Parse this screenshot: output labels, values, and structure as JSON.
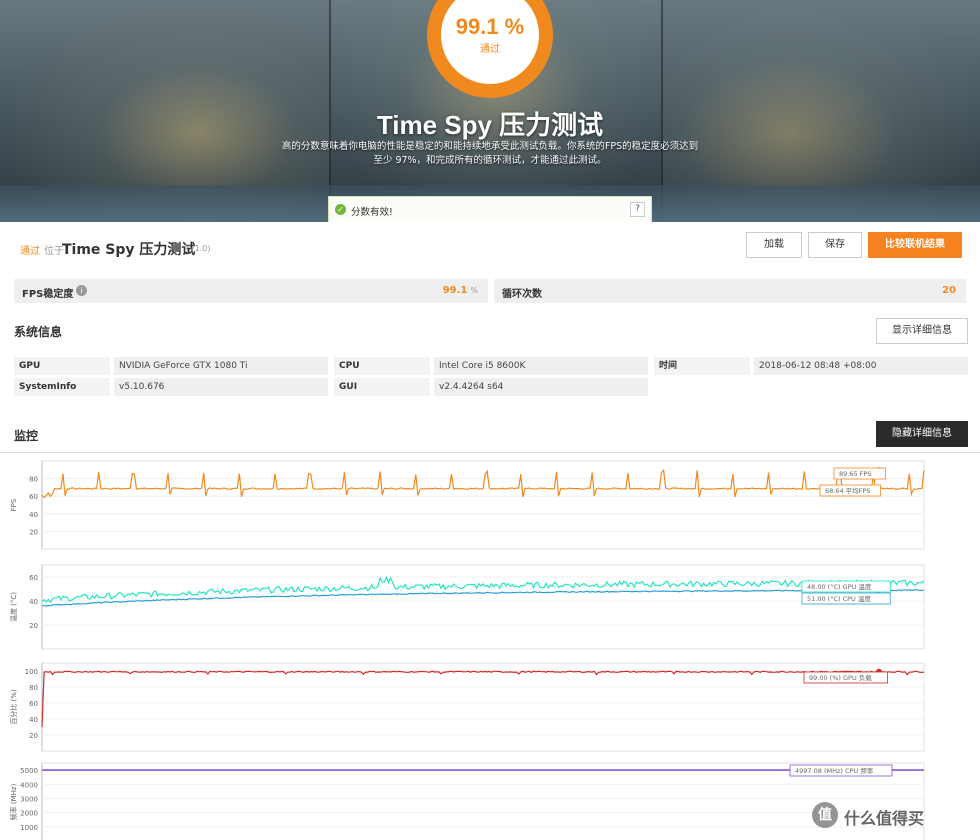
{
  "hero": {
    "score": "99.1 %",
    "status": "通过",
    "title": "Time Spy 压力测试",
    "description": "高的分数意味着你电脑的性能是稳定的和能持续地承受此测试负载。你系统的FPS的稳定度必须达到至少 97%，和完成所有的循环测试，才能通过此测试。",
    "valid_text": "分数有效!",
    "help_label": "?"
  },
  "result": {
    "status": "通过",
    "position_word": "位于",
    "test_name": "Time Spy 压力测试",
    "version": "(V1.0)",
    "load_label": "加载",
    "save_label": "保存",
    "compare_label": "比较联机结果"
  },
  "stats": {
    "fps_label": "FPS稳定度",
    "fps_value": "99.1",
    "fps_unit": "%",
    "loop_label": "循环次数",
    "loop_value": "20"
  },
  "system": {
    "title": "系统信息",
    "details_button": "显示详细信息",
    "gpu_key": "GPU",
    "gpu_val": "NVIDIA GeForce GTX 1080 Ti",
    "cpu_key": "CPU",
    "cpu_val": "Intel Core i5 8600K",
    "time_key": "时间",
    "time_val": "2018-06-12 08:48 +08:00",
    "sysinfo_key": "SystemInfo",
    "sysinfo_val": "v5.10.676",
    "gui_key": "GUI",
    "gui_val": "v2.4.4264 s64"
  },
  "monitor": {
    "title": "监控",
    "hide_button": "隐藏详细信息"
  },
  "chart_data": [
    {
      "type": "line",
      "ylabel": "FPS",
      "ylim": [
        0,
        100
      ],
      "yticks": [
        "80",
        "60",
        "40",
        "20"
      ],
      "series": [
        {
          "name": "FPS",
          "color": "#f08a1f",
          "baseline": 68.64,
          "peak": 89.65,
          "spike_count": 25
        }
      ],
      "labels": [
        "89.65 FPS",
        "68.64 平均FPS"
      ]
    },
    {
      "type": "line",
      "ylabel": "温度 (°C)",
      "ylim": [
        0,
        70
      ],
      "yticks": [
        "60",
        "40",
        "20"
      ],
      "series": [
        {
          "name": "GPU 温度",
          "color": "#23e5c0",
          "start": 40,
          "end": 54
        },
        {
          "name": "CPU 温度",
          "color": "#2a9fd6",
          "start": 36,
          "end": 49
        }
      ],
      "labels": [
        "48.00 (°C) GPU 温度",
        "51.00 (°C) CPU 温度"
      ]
    },
    {
      "type": "line",
      "ylabel": "百分比 (%)",
      "ylim": [
        0,
        110
      ],
      "yticks": [
        "100",
        "80",
        "60",
        "40",
        "20"
      ],
      "series": [
        {
          "name": "GPU 负载",
          "color": "#d42a2a",
          "value": 99
        }
      ],
      "labels": [
        "99.00 (%) GPU 负载"
      ]
    },
    {
      "type": "line",
      "ylabel": "频率 (MHz)",
      "ylim": [
        0,
        5500
      ],
      "yticks": [
        "5000",
        "4000",
        "3000",
        "2000",
        "1000"
      ],
      "series": [
        {
          "name": "CPU 频率",
          "color": "#8a55d6",
          "value": 4997.08
        }
      ],
      "labels": [
        "4997.08 (MHz) CPU 频率"
      ]
    }
  ],
  "watermark": {
    "logo": "值",
    "text": "什么值得买"
  }
}
